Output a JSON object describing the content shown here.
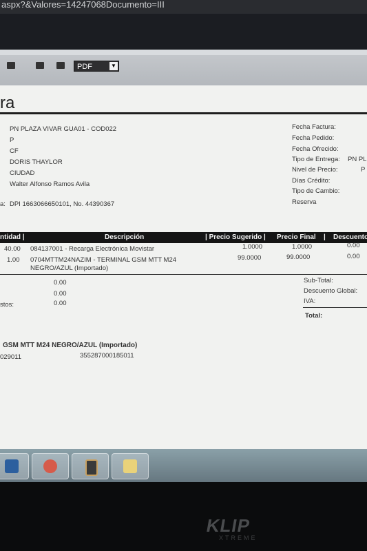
{
  "browser": {
    "url_fragment": "aspx?&Valores=14247068Documento=III"
  },
  "toolbar": {
    "format_select": "PDF"
  },
  "invoice": {
    "title_fragment": "ra",
    "client": {
      "company": "PN PLAZA VIVAR GUA01 - COD022",
      "line2": "P",
      "line3": "CF",
      "name": "DORIS THAYLOR",
      "city": "CIUDAD",
      "seller": "Walter Alfonso Ramos Avila",
      "id_prefix": "a:",
      "id_line": "DPI 1663066650101, No. 44390367"
    },
    "info_labels": {
      "fecha_factura": "Fecha Factura:",
      "fecha_pedido": "Fecha Pedido:",
      "fecha_ofrecido": "Fecha Ofrecido:",
      "tipo_entrega": "Tipo de Entrega:",
      "tipo_entrega_value": "PN PL",
      "nivel_precio": "Nivel de Precio:",
      "nivel_precio_value": "P",
      "dias_credito": "Días Crédito:",
      "tipo_cambio": "Tipo de Cambio:",
      "reserva": "Reserva"
    },
    "table": {
      "headers": {
        "cantidad": "ntidad |",
        "descripcion": "Descripción",
        "precio_sugerido": "| Precio Sugerido |",
        "precio_final": "Precio Final",
        "sep": "|",
        "descuento": "Descuento"
      },
      "rows": [
        {
          "qty": "40.00",
          "desc": "084137001 - Recarga Electrónica Movistar",
          "desc2": "",
          "sugerido": "1.0000",
          "final": "1.0000",
          "descuento": "0.00"
        },
        {
          "qty": "1.00",
          "desc": "0704MTTM24NAZIM - TERMINAL GSM MTT M24",
          "desc2": "NEGRO/AZUL (Importado)",
          "sugerido": "99.0000",
          "final": "99.0000",
          "descuento": "0.00"
        }
      ]
    },
    "totals_left": {
      "v1": "0.00",
      "v2": "0.00",
      "label3": "stos:",
      "v3": "0.00"
    },
    "totals_right": {
      "subtotal": "Sub-Total:",
      "descuento_global": "Descuento Global:",
      "iva": "IVA:",
      "total": "Total:"
    },
    "serials": {
      "product": "GSM MTT M24 NEGRO/AZUL (Importado)",
      "code": "029011",
      "imei": "355287000185011"
    }
  },
  "taskbar": {
    "apps": [
      "explorer-icon",
      "media-icon",
      "payment-terminal-icon",
      "files-icon"
    ]
  },
  "monitor": {
    "brand": "KLIP",
    "brand_sub": "XTREME"
  },
  "colors": {
    "paper": "#f1f2f0",
    "header_bar": "#151515",
    "taskbar": "#7a8e96"
  }
}
